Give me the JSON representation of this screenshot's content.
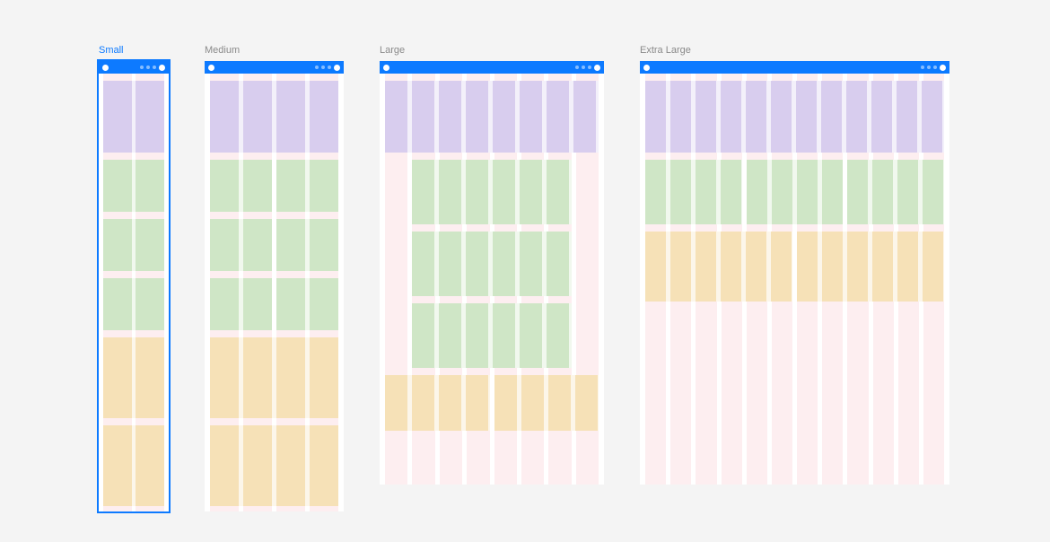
{
  "breakpoints": {
    "small": {
      "label": "Small",
      "columns": 2,
      "selected": true
    },
    "medium": {
      "label": "Medium",
      "columns": 4,
      "selected": false
    },
    "large": {
      "label": "Large",
      "columns": 8,
      "selected": false
    },
    "xlarge": {
      "label": "Extra Large",
      "columns": 12,
      "selected": false
    }
  },
  "colors": {
    "accent": "#0d7aff",
    "purple": "#d8cdee",
    "green": "#cfe6c6",
    "orange": "#f6e1b7",
    "column": "#fdeef0"
  }
}
